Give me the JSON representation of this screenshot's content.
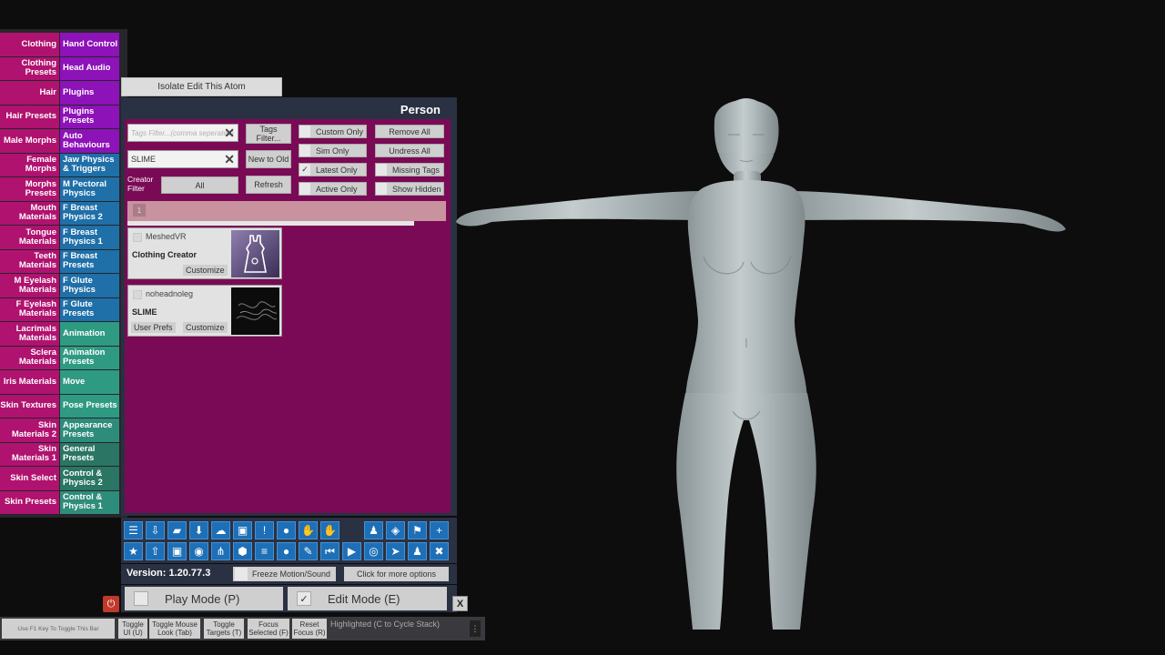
{
  "tabs": [
    {
      "left": "Clothing",
      "right": "Hand Control",
      "rc": "c-purple"
    },
    {
      "left": "Clothing Presets",
      "right": "Head Audio",
      "rc": "c-purple"
    },
    {
      "left": "Hair",
      "right": "Plugins",
      "rc": "c-purple"
    },
    {
      "left": "Hair Presets",
      "right": "Plugins Presets",
      "rc": "c-purple"
    },
    {
      "left": "Male Morphs",
      "right": "Auto Behaviours",
      "rc": "c-purple"
    },
    {
      "left": "Female Morphs",
      "right": "Jaw Physics & Triggers",
      "rc": "c-blue"
    },
    {
      "left": "Morphs Presets",
      "right": "M Pectoral Physics",
      "rc": "c-blue"
    },
    {
      "left": "Mouth Materials",
      "right": "F Breast Physics 2",
      "rc": "c-blue"
    },
    {
      "left": "Tongue Materials",
      "right": "F Breast Physics 1",
      "rc": "c-blue"
    },
    {
      "left": "Teeth Materials",
      "right": "F Breast Presets",
      "rc": "c-blue"
    },
    {
      "left": "M Eyelash Materials",
      "right": "F Glute Physics",
      "rc": "c-blue"
    },
    {
      "left": "F Eyelash Materials",
      "right": "F Glute Presets",
      "rc": "c-blue"
    },
    {
      "left": "Lacrimals Materials",
      "right": "Animation",
      "rc": "c-teal"
    },
    {
      "left": "Sclera Materials",
      "right": "Animation Presets",
      "rc": "c-teal"
    },
    {
      "left": "Iris Materials",
      "right": "Move",
      "rc": "c-teal"
    },
    {
      "left": "Skin Textures",
      "right": "Pose Presets",
      "rc": "c-teal"
    },
    {
      "left": "Skin Materials 2",
      "right": "Appearance Presets",
      "rc": "c-gteal"
    },
    {
      "left": "Skin Materials 1",
      "right": "General Presets",
      "rc": "c-dteal"
    },
    {
      "left": "Skin Select",
      "right": "Control & Physics 2",
      "rc": "c-dteal"
    },
    {
      "left": "Skin Presets",
      "right": "Control & Physics 1",
      "rc": "c-gteal"
    }
  ],
  "isolate_label": "Isolate Edit This Atom",
  "panel_title": "Person",
  "tags_filter_placeholder": "Tags Filter...(comma seperated)",
  "search_value": "SLIME",
  "tags_filter_btn": "Tags Filter...",
  "sort_btn": "New to Old",
  "creator_filter_label": "Creator Filter",
  "creator_filter_value": "All",
  "refresh_btn": "Refresh",
  "toggles": {
    "custom_only": "Custom Only",
    "sim_only": "Sim Only",
    "latest_only": "Latest Only",
    "active_only": "Active Only",
    "remove_all": "Remove All",
    "undress_all": "Undress All",
    "missing_tags": "Missing Tags",
    "show_hidden": "Show Hidden"
  },
  "check_mark": "✓",
  "page_number": "1",
  "items": [
    {
      "creator": "MeshedVR",
      "name": "Clothing Creator",
      "customize": "Customize"
    },
    {
      "creator": "noheadnoleg",
      "name": "SLIME",
      "user_prefs": "User Prefs",
      "customize": "Customize"
    }
  ],
  "toolbar_row1": [
    "☰",
    "⇩",
    "▰",
    "⬇",
    "☁",
    "▣",
    "!",
    "●",
    "✋",
    "✋",
    "",
    "♟",
    "◈",
    "⚑",
    "+"
  ],
  "toolbar_row2": [
    "★",
    "⇧",
    "▣",
    "◉",
    "⋔",
    "⬢",
    "≡",
    "●",
    "✎",
    "⏮",
    "▶",
    "◎",
    "➤",
    "♟",
    "✖"
  ],
  "version": "Version: 1.20.77.3",
  "freeze_label": "Freeze Motion/Sound",
  "more_options": "Click for more options",
  "play_mode": "Play Mode (P)",
  "edit_mode": "Edit Mode (E)",
  "power_icon": "⏻",
  "close_label": "X",
  "f1_hint": "Use F1 Key To Toggle This Bar",
  "bottom_buttons": [
    "Toggle UI (U)",
    "Toggle Mouse Look (Tab)",
    "Toggle Targets (T)",
    "Focus Selected (F)",
    "Reset Focus (R)"
  ],
  "highlight_text": "Highlighted (C to Cycle Stack)",
  "menu_icon": "⋮",
  "colors": {
    "panel_bg": "#7a0a55",
    "tab_left": "#b0126f",
    "header": "#2a3142"
  }
}
